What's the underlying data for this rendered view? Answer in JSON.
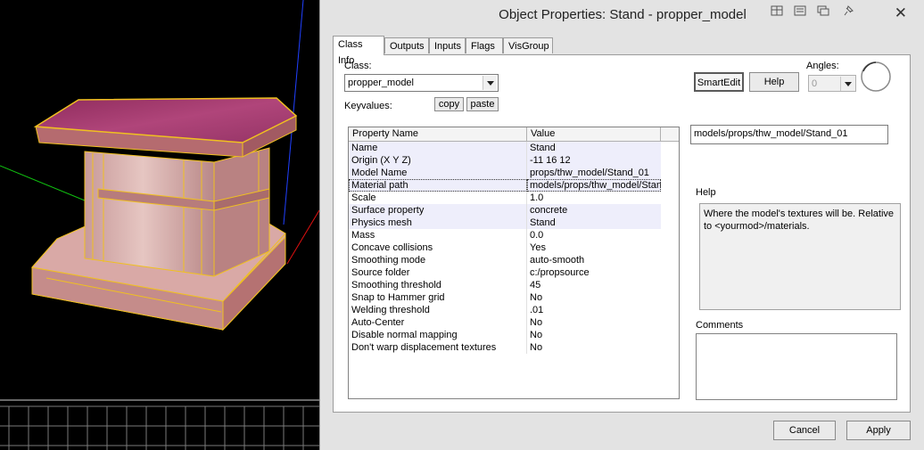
{
  "window": {
    "title": "Object Properties: Stand - propper_model"
  },
  "tabs": [
    "Class Info",
    "Outputs",
    "Inputs",
    "Flags",
    "VisGroup"
  ],
  "class_info": {
    "class_label": "Class:",
    "class_value": "propper_model",
    "keyvalues_label": "Keyvalues:",
    "copy_label": "copy",
    "paste_label": "paste",
    "smartedit_label": "SmartEdit",
    "help_button_label": "Help",
    "angles_label": "Angles:",
    "angles_value": "0",
    "table": {
      "headers": [
        "Property Name",
        "Value"
      ],
      "rows": [
        {
          "name": "Name",
          "value": "Stand"
        },
        {
          "name": "Origin (X Y Z)",
          "value": "-11 16 12"
        },
        {
          "name": "Model Name",
          "value": "props/thw_model/Stand_01"
        },
        {
          "name": "Material path",
          "value": "models/props/thw_model/Stan"
        },
        {
          "name": "Scale",
          "value": "1.0"
        },
        {
          "name": "Surface property",
          "value": "concrete"
        },
        {
          "name": "Physics mesh",
          "value": "Stand"
        },
        {
          "name": "Mass",
          "value": "0.0"
        },
        {
          "name": "Concave collisions",
          "value": "Yes"
        },
        {
          "name": "Smoothing mode",
          "value": "auto-smooth"
        },
        {
          "name": "Source folder",
          "value": "c:/propsource"
        },
        {
          "name": "Smoothing threshold",
          "value": "45"
        },
        {
          "name": "Snap to Hammer grid",
          "value": "No"
        },
        {
          "name": "Welding threshold",
          "value": ".01"
        },
        {
          "name": "Auto-Center",
          "value": "No"
        },
        {
          "name": "Disable normal mapping",
          "value": "No"
        },
        {
          "name": "Don't warp displacement textures",
          "value": "No"
        }
      ]
    },
    "value_field": "models/props/thw_model/Stand_01",
    "help_section_label": "Help",
    "help_text": "Where the model's textures will be. Relative to <yourmod>/materials.",
    "comments_label": "Comments"
  },
  "buttons": {
    "cancel": "Cancel",
    "apply": "Apply"
  },
  "colors": {
    "dialog_bg": "#e3e3e3",
    "highlight_row": "#eeeefb",
    "wire_outline": "#f0c020",
    "stand_top": "#a8356e"
  }
}
